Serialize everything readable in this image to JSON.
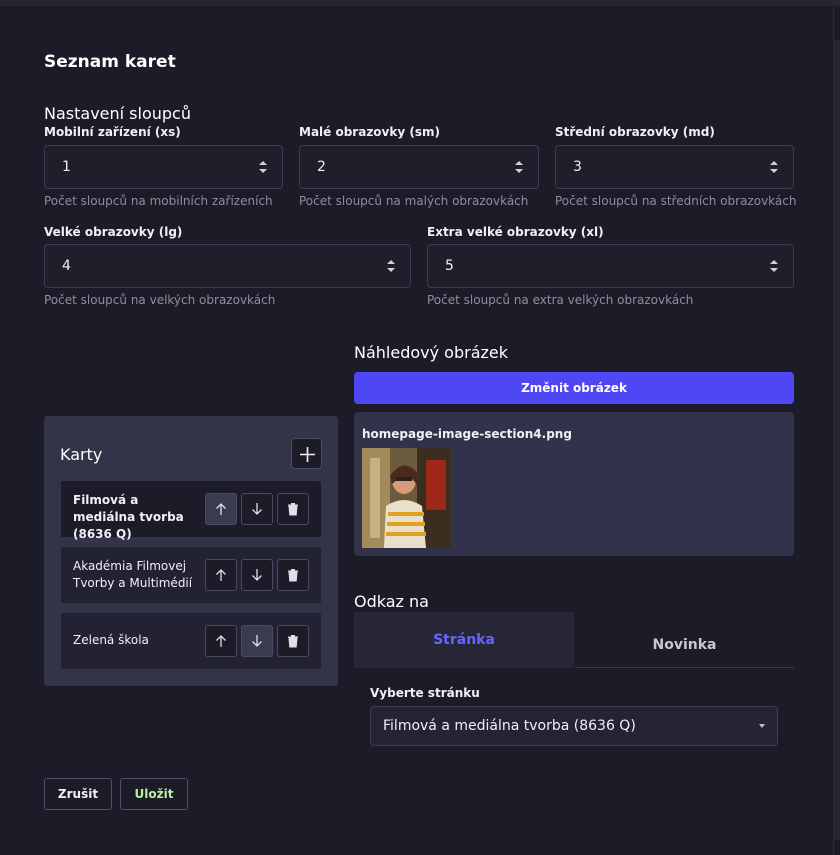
{
  "modal": {
    "title": "Seznam karet"
  },
  "columns": {
    "title": "Nastavení sloupců",
    "xs": {
      "label": "Mobilní zařízení (xs)",
      "value": "1",
      "helper": "Počet sloupců na mobilních zařízeních"
    },
    "sm": {
      "label": "Malé obrazovky (sm)",
      "value": "2",
      "helper": "Počet sloupců na malých obrazovkách"
    },
    "md": {
      "label": "Střední obrazovky (md)",
      "value": "3",
      "helper": "Počet sloupců na středních obrazovkách"
    },
    "lg": {
      "label": "Velké obrazovky (lg)",
      "value": "4",
      "helper": "Počet sloupců na velkých obrazovkách"
    },
    "xl": {
      "label": "Extra velké obrazovky (xl)",
      "value": "5",
      "helper": "Počet sloupců na extra velkých obrazovkách"
    }
  },
  "preview": {
    "title": "Náhledový obrázek",
    "change_button": "Změnit obrázek",
    "file_name": "homepage-image-section4.png"
  },
  "cards": {
    "title": "Karty",
    "items": [
      {
        "label": "Filmová a mediálna tvorba (8636 Q)",
        "selected": true
      },
      {
        "label": "Akadémia Filmovej Tvorby a Multimédií",
        "selected": false
      },
      {
        "label": "Zelená škola",
        "selected": false
      }
    ]
  },
  "link": {
    "title": "Odkaz na",
    "tabs": [
      "Stránka",
      "Novinka"
    ],
    "active_tab": "Stránka",
    "select_label": "Vyberte stránku",
    "select_value": "Filmová a mediálna tvorba (8636 Q)"
  },
  "footer": {
    "cancel": "Zrušit",
    "save": "Uložit"
  },
  "colors": {
    "accent": "#4f46f6",
    "tab_active": "#6a64ff",
    "save_text": "#b6f0a8"
  },
  "icons": [
    "plus-icon",
    "arrow-up-icon",
    "arrow-down-icon",
    "trash-icon",
    "spinner-icon",
    "caret-down-icon"
  ]
}
